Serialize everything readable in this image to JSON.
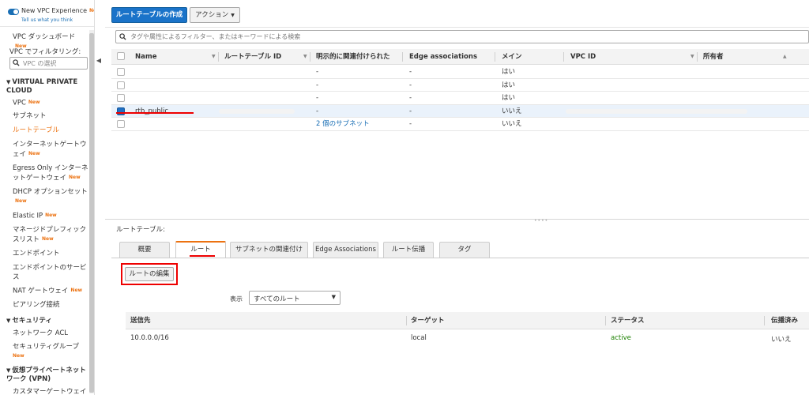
{
  "sidebar": {
    "title": "New VPC Experience",
    "new_badge": "New",
    "tell_us": "Tell us what you think",
    "dashboard": "VPC ダッシュボード",
    "filter_label": "VPC でフィルタリング:",
    "filter_placeholder": "VPC の選択",
    "sections": [
      {
        "title": "VIRTUAL PRIVATE CLOUD"
      },
      {
        "title": "セキュリティ"
      },
      {
        "title": "仮想プライベートネットワーク (VPN)"
      }
    ],
    "items": [
      {
        "label": "VPC",
        "new": "New"
      },
      {
        "label": "サブネット"
      },
      {
        "label": "ルートテーブル"
      },
      {
        "label": "インターネットゲートウェイ",
        "new": "New"
      },
      {
        "label": "Egress Only インターネットゲートウェイ",
        "new": "New"
      },
      {
        "label": "DHCP オプションセット",
        "new": "New"
      },
      {
        "label": "Elastic IP",
        "new": "New"
      },
      {
        "label": "マネージドプレフィックスリスト",
        "new": "New"
      },
      {
        "label": "エンドポイント"
      },
      {
        "label": "エンドポイントのサービス"
      },
      {
        "label": "NAT ゲートウェイ",
        "new": "New"
      },
      {
        "label": "ピアリング接続"
      },
      {
        "label": "ネットワーク ACL"
      },
      {
        "label": "セキュリティグループ",
        "new": "New"
      },
      {
        "label": "カスタマーゲートウェイ"
      }
    ]
  },
  "toolbar": {
    "create_label": "ルートテーブルの作成",
    "action_label": "アクション"
  },
  "search": {
    "placeholder": "タグや属性によるフィルター、またはキーワードによる検索"
  },
  "table": {
    "columns": [
      "Name",
      "ルートテーブル ID",
      "明示的に関連付けられた",
      "Edge associations",
      "メイン",
      "VPC ID",
      "所有者"
    ],
    "rows": [
      {
        "name": "",
        "explicit": "-",
        "edge": "-",
        "main": "はい",
        "selected": false
      },
      {
        "name": "",
        "explicit": "-",
        "edge": "-",
        "main": "はい",
        "selected": false
      },
      {
        "name": "",
        "explicit": "-",
        "edge": "-",
        "main": "はい",
        "selected": false
      },
      {
        "name": "rtb_public",
        "explicit": "-",
        "edge": "-",
        "main": "いいえ",
        "selected": true
      },
      {
        "name": "",
        "explicit": "2 個のサブネット",
        "edge": "-",
        "main": "いいえ",
        "selected": false
      }
    ]
  },
  "detail": {
    "label": "ルートテーブル:",
    "tabs": [
      "概要",
      "ルート",
      "サブネットの関連付け",
      "Edge Associations",
      "ルート伝播",
      "タグ"
    ],
    "active_tab": "ルート",
    "edit_label": "ルートの編集",
    "show_label": "表示",
    "show_value": "すべてのルート",
    "route_columns": [
      "送信先",
      "ターゲット",
      "ステータス",
      "伝播済み"
    ],
    "routes": [
      {
        "destination": "10.0.0.0/16",
        "target": "local",
        "status": "active",
        "propagated": "いいえ"
      }
    ]
  },
  "colors": {
    "accent": "#ec7211",
    "primary": "#1a73c9",
    "status_active": "#1d8102",
    "annotation": "#e00000"
  }
}
